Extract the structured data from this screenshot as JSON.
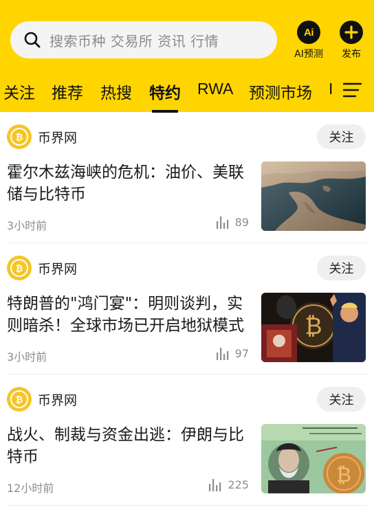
{
  "search": {
    "placeholder": "搜索币种 交易所 资讯 行情"
  },
  "header_buttons": [
    {
      "icon": "ai-icon",
      "icon_text": "Ai",
      "label": "AI预测"
    },
    {
      "icon": "plus-icon",
      "label": "发布"
    }
  ],
  "tabs": [
    {
      "label": "关注"
    },
    {
      "label": "推荐"
    },
    {
      "label": "热搜"
    },
    {
      "label": "特约",
      "active": true
    },
    {
      "label": "RWA"
    },
    {
      "label": "预测市场"
    },
    {
      "label": "I"
    }
  ],
  "colors": {
    "accent": "#FFD500",
    "text": "#1a1a1a",
    "muted": "#8c8c8c",
    "follow_bg": "#EFEFEF"
  },
  "articles": [
    {
      "source": "币界网",
      "follow_label": "关注",
      "title": "霍尔木兹海峡的危机：油价、美联储与比特币",
      "time": "3小时前",
      "views": "89",
      "thumb": "satellite-map-strait-image"
    },
    {
      "source": "币界网",
      "follow_label": "关注",
      "title": "特朗普的\"鸿门宴\"：明则谈判，实则暗杀！全球市场已开启地狱模式",
      "time": "3小时前",
      "views": "97",
      "thumb": "politics-bitcoin-collage-image"
    },
    {
      "source": "币界网",
      "follow_label": "关注",
      "title": "战火、制裁与资金出逃：伊朗与比特币",
      "time": "12小时前",
      "views": "225",
      "thumb": "iran-banknote-bitcoin-image"
    }
  ]
}
